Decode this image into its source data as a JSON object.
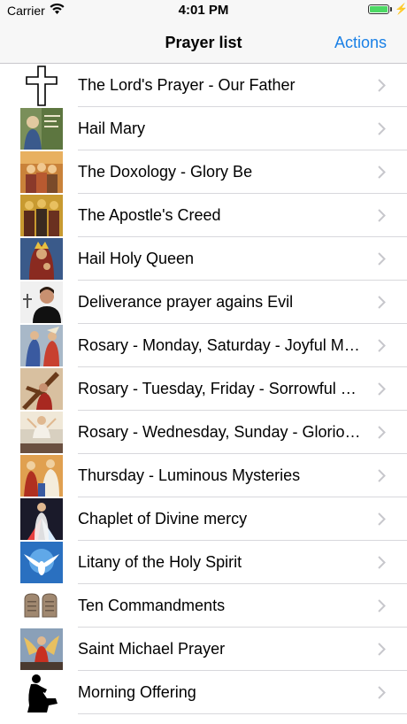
{
  "status": {
    "carrier": "Carrier",
    "time": "4:01 PM"
  },
  "nav": {
    "title": "Prayer list",
    "action": "Actions"
  },
  "items": [
    {
      "label": "The Lord's Prayer - Our Father",
      "icon": "cross-outline-icon"
    },
    {
      "label": "Hail Mary",
      "icon": "hail-mary-image"
    },
    {
      "label": "The Doxology - Glory Be",
      "icon": "doxology-image"
    },
    {
      "label": "The Apostle's Creed",
      "icon": "apostles-image"
    },
    {
      "label": "Hail Holy Queen",
      "icon": "holy-queen-image"
    },
    {
      "label": "Deliverance prayer agains Evil",
      "icon": "priest-image"
    },
    {
      "label": "Rosary - Monday, Saturday - Joyful Mysteries",
      "icon": "joyful-image"
    },
    {
      "label": "Rosary - Tuesday, Friday - Sorrowful Mysteries",
      "icon": "sorrowful-image"
    },
    {
      "label": "Rosary - Wednesday, Sunday - Glorious Mysteries",
      "icon": "glorious-image"
    },
    {
      "label": "Thursday - Luminous Mysteries",
      "icon": "luminous-image"
    },
    {
      "label": "Chaplet of Divine mercy",
      "icon": "divine-mercy-image"
    },
    {
      "label": "Litany of the Holy Spirit",
      "icon": "dove-image"
    },
    {
      "label": "Ten Commandments",
      "icon": "tablets-image"
    },
    {
      "label": "Saint Michael Prayer",
      "icon": "saint-michael-image"
    },
    {
      "label": "Morning Offering",
      "icon": "kneeling-image"
    }
  ],
  "colors": {
    "accent": "#1a80e6",
    "battery": "#4cd964",
    "separator": "#d8d8dc"
  }
}
